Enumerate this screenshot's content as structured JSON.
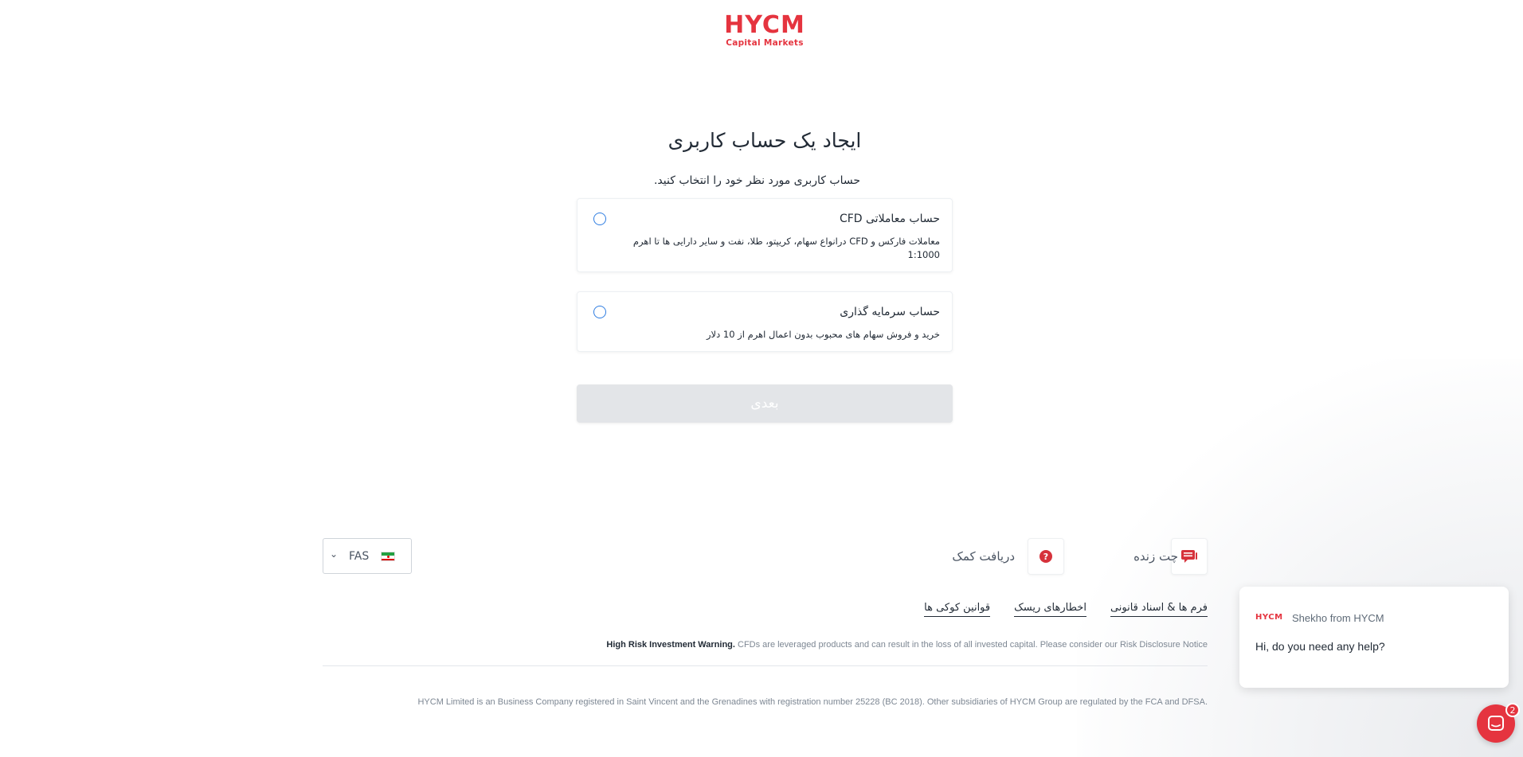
{
  "brand": {
    "logo_main": "HYCM",
    "logo_sub": "Capital Markets",
    "color": "#e5343f"
  },
  "main": {
    "title": "ایجاد یک حساب کاربری",
    "subtitle": "حساب کاربری مورد نظر خود را انتخاب کنید.",
    "accounts": [
      {
        "title": "حساب معاملاتی CFD",
        "description": "معاملات فارکس و CFD درانواع سهام، کریپتو، طلا، نفت و سایر دارایی ها تا اهرم 1:1000",
        "selected": false
      },
      {
        "title": "حساب سرمایه گذاری",
        "description": "خرید و فروش سهام های محبوب بدون اعمال اهرم از 10 دلار",
        "selected": false
      }
    ],
    "next_label": "بعدی"
  },
  "footer": {
    "live_chat_label": "چت زنده",
    "help_label": "دریافت کمک",
    "language_code": "FAS",
    "links": [
      "فرم ها & اسناد قانونی",
      "اخطارهای ریسک",
      "قوانین کوکی ها"
    ],
    "warning_bold": "High Risk Investment Warning.",
    "warning_text": " CFDs are leveraged products and can result in the loss of all invested capital. Please consider our Risk Disclosure Notice",
    "registration": "HYCM Limited is an Business Company registered in Saint Vincent and the Grenadines with registration number 25228 (BC 2018). Other subsidiaries of HYCM Group are regulated by the FCA and DFSA."
  },
  "chat": {
    "mini_logo": "HYCM",
    "sender": "Shekho from HYCM",
    "message": "Hi, do you need any help?",
    "badge_count": "2"
  }
}
